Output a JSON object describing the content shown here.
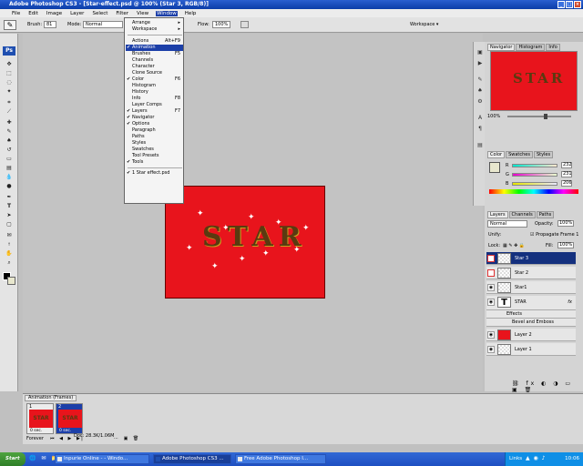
{
  "window": {
    "title": "Adobe Photoshop CS3 - [Star-effect.psd @ 100% (Star 3, RGB/8)]",
    "min": "_",
    "max": "□",
    "close": "×"
  },
  "menubar": [
    "File",
    "Edit",
    "Image",
    "Layer",
    "Select",
    "Filter",
    "View",
    "Window",
    "Help"
  ],
  "options": {
    "brush_label": "Brush:",
    "brush_size": "81",
    "mode_label": "Mode:",
    "mode_value": "Normal",
    "flow_label": "Flow:",
    "flow_value": "100%",
    "workspace": "Workspace ▾"
  },
  "window_menu": {
    "top_items": [
      "Arrange",
      "Workspace"
    ],
    "items": [
      {
        "label": "Actions",
        "shortcut": "Alt+F9",
        "checked": false
      },
      {
        "label": "Animation",
        "shortcut": "",
        "checked": true,
        "highlighted": true
      },
      {
        "label": "Brushes",
        "shortcut": "F5",
        "checked": false
      },
      {
        "label": "Channels",
        "shortcut": "",
        "checked": false
      },
      {
        "label": "Character",
        "shortcut": "",
        "checked": false
      },
      {
        "label": "Clone Source",
        "shortcut": "",
        "checked": false
      },
      {
        "label": "Color",
        "shortcut": "F6",
        "checked": true
      },
      {
        "label": "Histogram",
        "shortcut": "",
        "checked": false
      },
      {
        "label": "History",
        "shortcut": "",
        "checked": false
      },
      {
        "label": "Info",
        "shortcut": "F8",
        "checked": false
      },
      {
        "label": "Layer Comps",
        "shortcut": "",
        "checked": false
      },
      {
        "label": "Layers",
        "shortcut": "F7",
        "checked": true
      },
      {
        "label": "Navigator",
        "shortcut": "",
        "checked": true
      },
      {
        "label": "Options",
        "shortcut": "",
        "checked": true
      },
      {
        "label": "Paragraph",
        "shortcut": "",
        "checked": false
      },
      {
        "label": "Paths",
        "shortcut": "",
        "checked": false
      },
      {
        "label": "Styles",
        "shortcut": "",
        "checked": false
      },
      {
        "label": "Swatches",
        "shortcut": "",
        "checked": false
      },
      {
        "label": "Tool Presets",
        "shortcut": "",
        "checked": false
      },
      {
        "label": "Tools",
        "shortcut": "",
        "checked": true
      }
    ],
    "doc_item": "1 Star effect.psd"
  },
  "canvas": {
    "text": "STAR",
    "bg": "#e8141c",
    "text_color": "#5a3a10"
  },
  "navigator": {
    "tabs": [
      "Navigator",
      "Histogram",
      "Info"
    ],
    "zoom": "100%",
    "thumb_text": "STAR"
  },
  "color": {
    "tabs": [
      "Color",
      "Swatches",
      "Styles"
    ],
    "channels": [
      {
        "label": "R",
        "value": "232"
      },
      {
        "label": "G",
        "value": "231"
      },
      {
        "label": "B",
        "value": "206"
      }
    ]
  },
  "layers": {
    "tabs": [
      "Layers",
      "Channels",
      "Paths"
    ],
    "blend": "Normal",
    "opacity_label": "Opacity:",
    "opacity": "100%",
    "unify_label": "Unify:",
    "propagate": "Propagate Frame 1",
    "lock_label": "Lock:",
    "fill_label": "Fill:",
    "fill": "100%",
    "items": [
      {
        "name": "Star 3",
        "selected": true,
        "visible": false
      },
      {
        "name": "Star 2",
        "selected": false,
        "visible": false
      },
      {
        "name": "Star1",
        "selected": false,
        "visible": true
      },
      {
        "name": "STAR",
        "selected": false,
        "visible": true,
        "type": "text",
        "fx": "fx"
      },
      {
        "name": "Effects",
        "sub": true
      },
      {
        "name": "Bevel and Emboss",
        "sub": true
      },
      {
        "name": "Layer 2",
        "selected": false,
        "visible": true,
        "type": "red"
      },
      {
        "name": "Layer 1",
        "selected": false,
        "visible": true
      }
    ]
  },
  "animation": {
    "title": "Animation (Frames)",
    "frames": [
      {
        "num": "1",
        "delay": "0 sec."
      },
      {
        "num": "2",
        "delay": "0 sec."
      }
    ],
    "loop": "Forever"
  },
  "taskbar": {
    "start": "Start",
    "tasks": [
      "Inpurie Online - - Windo...",
      "Adobe Photoshop CS3 ...",
      "Free Adobe Photoshop I..."
    ],
    "tray": {
      "links": "Links",
      "time": "10:06"
    }
  },
  "status": "Doc: 28.3K/1.06M"
}
